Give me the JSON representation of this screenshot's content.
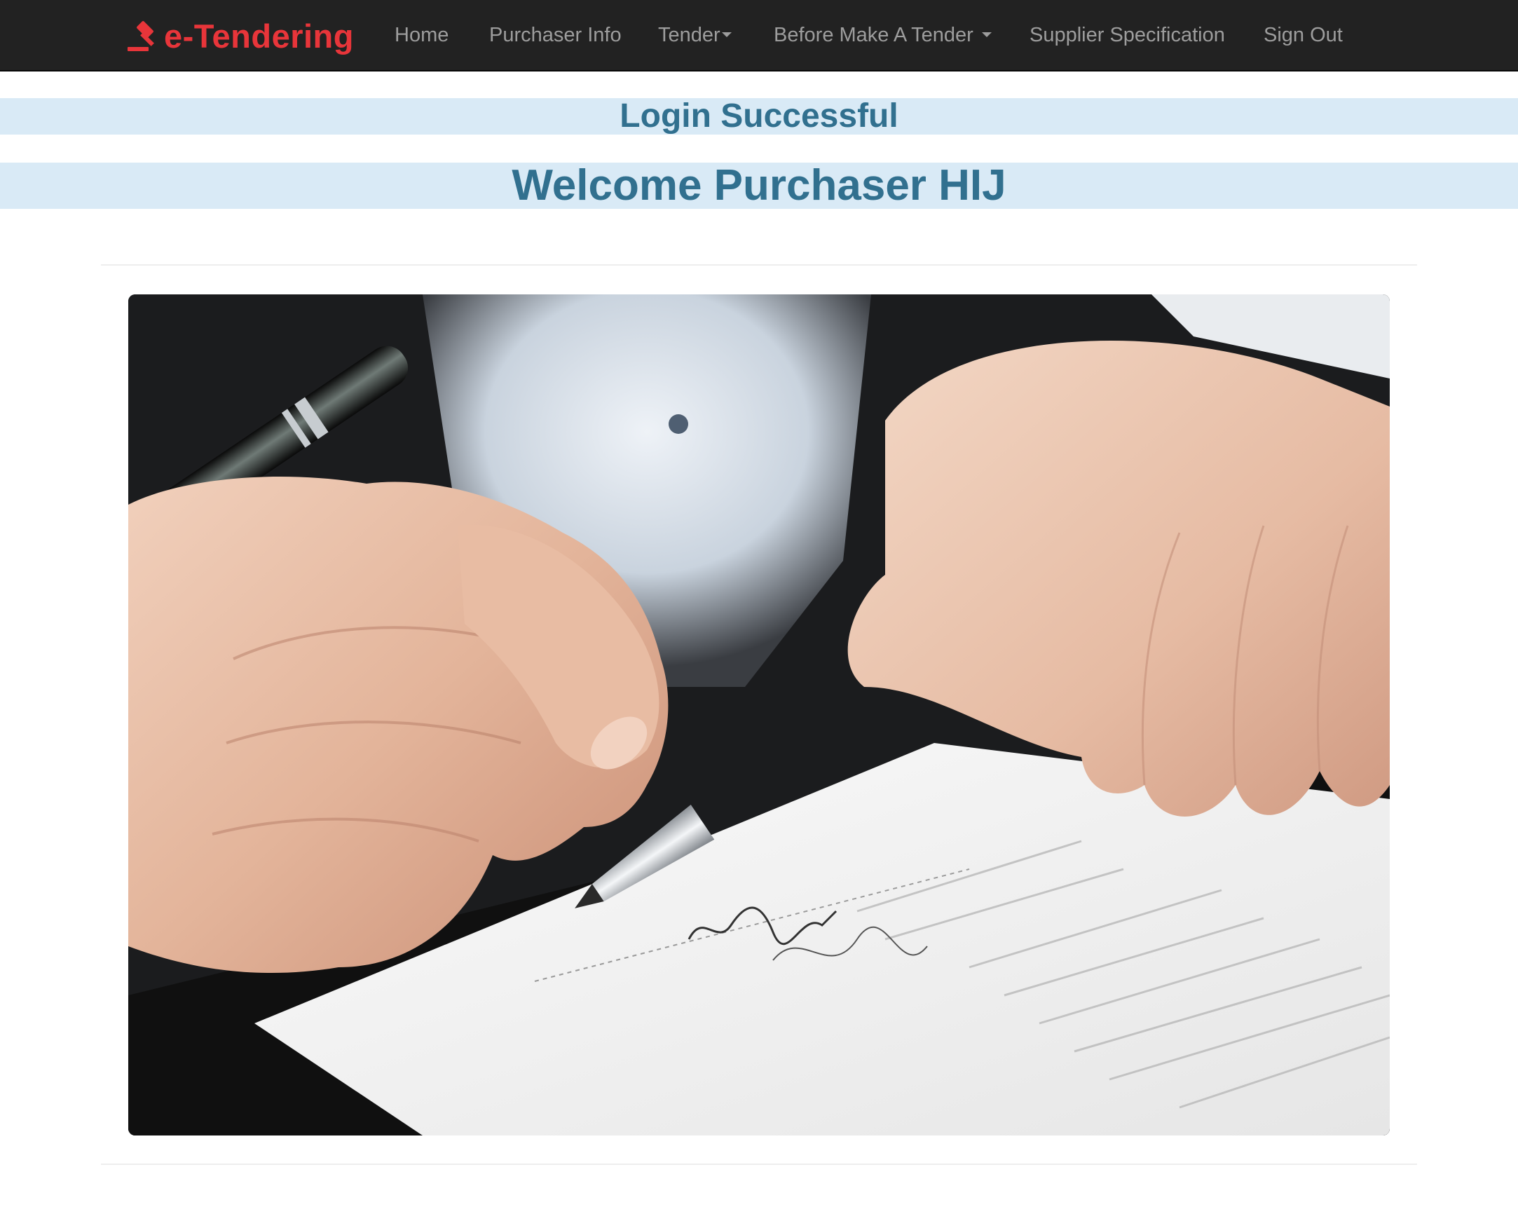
{
  "navbar": {
    "brand": "e-Tendering",
    "brand_icon": "gavel-icon",
    "items": [
      {
        "label": "Home"
      },
      {
        "label": "Purchaser Info"
      },
      {
        "label": "Tender",
        "dropdown": true
      },
      {
        "label": "Before Make A Tender",
        "dropdown": true
      },
      {
        "label": "Supplier Specification"
      },
      {
        "label": "Sign Out"
      }
    ]
  },
  "alerts": {
    "login": "Login Successful",
    "welcome": "Welcome Purchaser HIJ"
  },
  "hero": {
    "image": "hand signing a document with a pen"
  },
  "colors": {
    "navbar_bg": "#222222",
    "nav_text": "#9d9d9d",
    "brand": "#e8353a",
    "alert_bg": "#d9eaf6",
    "alert_text": "#31708f"
  }
}
